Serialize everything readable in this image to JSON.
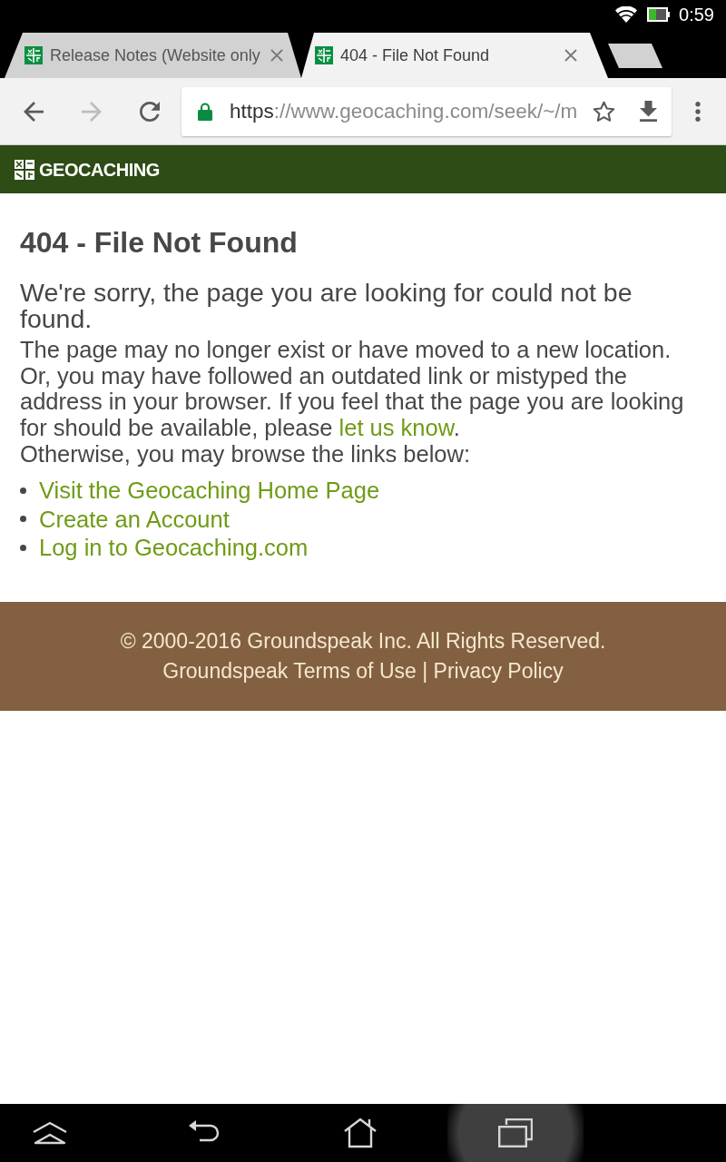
{
  "status_bar": {
    "time": "0:59"
  },
  "tabs": [
    {
      "title": "Release Notes (Website only",
      "selected": false
    },
    {
      "title": "404 - File Not Found",
      "selected": true
    }
  ],
  "toolbar": {
    "nav_buttons": [
      {
        "kind": "back",
        "disabled": false
      },
      {
        "kind": "forward",
        "disabled": true
      },
      {
        "kind": "reload",
        "disabled": false
      }
    ],
    "secure": true,
    "url": {
      "scheme": "https",
      "rest": "://www.geocaching.com/seek/~/m"
    }
  },
  "site_header": {
    "logo_text": "GEOCACHING"
  },
  "content": {
    "title": "404 - File Not Found",
    "subtitle": "We're sorry, the page you are looking for could not be found.",
    "paragraph": {
      "text": "The page may no longer exist or have moved to a new location. Or, you may have followed an outdated link or mistyped the address in your browser. If you feel that the page you are looking for should be available, please ",
      "link": "let us know",
      "text_after": "."
    },
    "note": "Otherwise, you may browse the links below:",
    "links": [
      "Visit the Geocaching Home Page",
      "Create an Account",
      "Log in to Geocaching.com"
    ]
  },
  "footer": {
    "copyright": "© 2000-2016 Groundspeak Inc. All Rights Reserved.",
    "links": [
      "Groundspeak Terms of Use",
      "Privacy Policy"
    ],
    "separator": "|"
  },
  "system_nav": [
    {
      "kind": "collapse",
      "pressed": false
    },
    {
      "kind": "back",
      "pressed": false
    },
    {
      "kind": "home",
      "pressed": false
    },
    {
      "kind": "recents",
      "pressed": true
    }
  ]
}
